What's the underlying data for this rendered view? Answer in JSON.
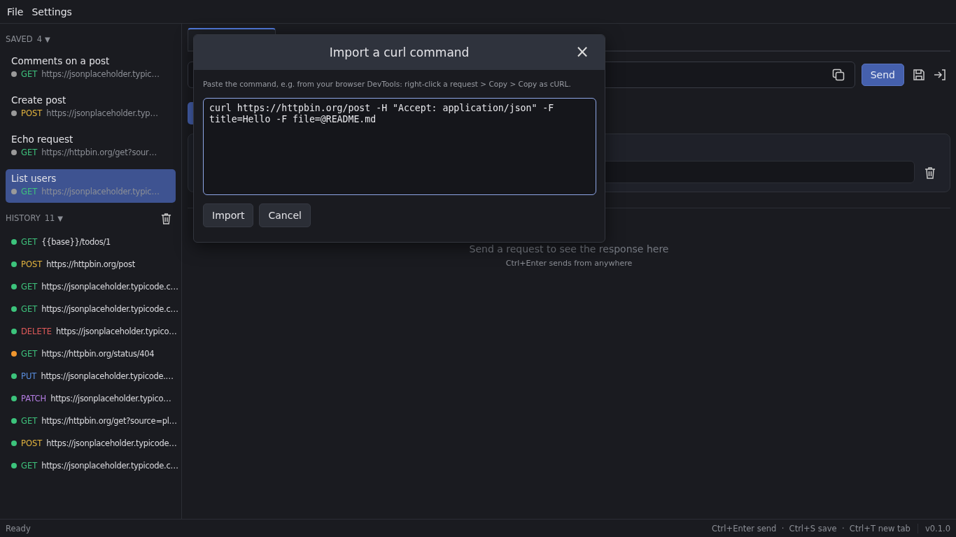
{
  "menu": [
    "File",
    "Settings"
  ],
  "saved": {
    "label": "SAVED",
    "count": "4",
    "caret": "▼",
    "items": [
      {
        "name": "Comments on a post",
        "method": "GET",
        "url": "https://jsonplaceholder.typic…",
        "color": "#9a9a9a",
        "selected": false
      },
      {
        "name": "Create post",
        "method": "POST",
        "url": "https://jsonplaceholder.typ…",
        "color": "#9a9a9a",
        "selected": false
      },
      {
        "name": "Echo request",
        "method": "GET",
        "url": "https://httpbin.org/get?sour…",
        "color": "#9a9a9a",
        "selected": false
      },
      {
        "name": "List users",
        "method": "GET",
        "url": "https://jsonplaceholder.typic…",
        "color": "#9a9a9a",
        "selected": true
      }
    ]
  },
  "history": {
    "label": "HISTORY",
    "count": "11",
    "caret": "▼",
    "items": [
      {
        "method": "GET",
        "url": "{{base}}/todos/1",
        "color": "#3cc47c"
      },
      {
        "method": "POST",
        "url": "https://httpbin.org/post",
        "color": "#3cc47c"
      },
      {
        "method": "GET",
        "url": "https://jsonplaceholder.typicode.c…",
        "color": "#3cc47c"
      },
      {
        "method": "GET",
        "url": "https://jsonplaceholder.typicode.c…",
        "color": "#3cc47c"
      },
      {
        "method": "DELETE",
        "url": "https://jsonplaceholder.typico…",
        "color": "#3cc47c"
      },
      {
        "method": "GET",
        "url": "https://httpbin.org/status/404",
        "color": "#f0962e"
      },
      {
        "method": "PUT",
        "url": "https://jsonplaceholder.typicode.…",
        "color": "#3cc47c"
      },
      {
        "method": "PATCH",
        "url": "https://jsonplaceholder.typico…",
        "color": "#3cc47c"
      },
      {
        "method": "GET",
        "url": "https://httpbin.org/get?source=pl…",
        "color": "#3cc47c"
      },
      {
        "method": "POST",
        "url": "https://jsonplaceholder.typicode…",
        "color": "#3cc47c"
      },
      {
        "method": "GET",
        "url": "https://jsonplaceholder.typicode.c…",
        "color": "#3cc47c"
      }
    ]
  },
  "request": {
    "send": "Send"
  },
  "response": {
    "placeholder": "Send a request to see the response here",
    "hint": "Ctrl+Enter sends from anywhere"
  },
  "dialog": {
    "title": "Import a curl command",
    "close": "×",
    "description": "Paste the command, e.g. from your browser DevTools: right-click a request > Copy > Copy as cURL.",
    "command": "curl https://httpbin.org/post -H \"Accept: application/json\" -F title=Hello -F file=@README.md",
    "buttons": [
      "Import",
      "Cancel"
    ]
  },
  "status_bar": {
    "status": "Ready",
    "shortcuts": "Ctrl+Enter send  ·  Ctrl+S save  ·  Ctrl+T new tab",
    "version": "v0.1.0"
  }
}
